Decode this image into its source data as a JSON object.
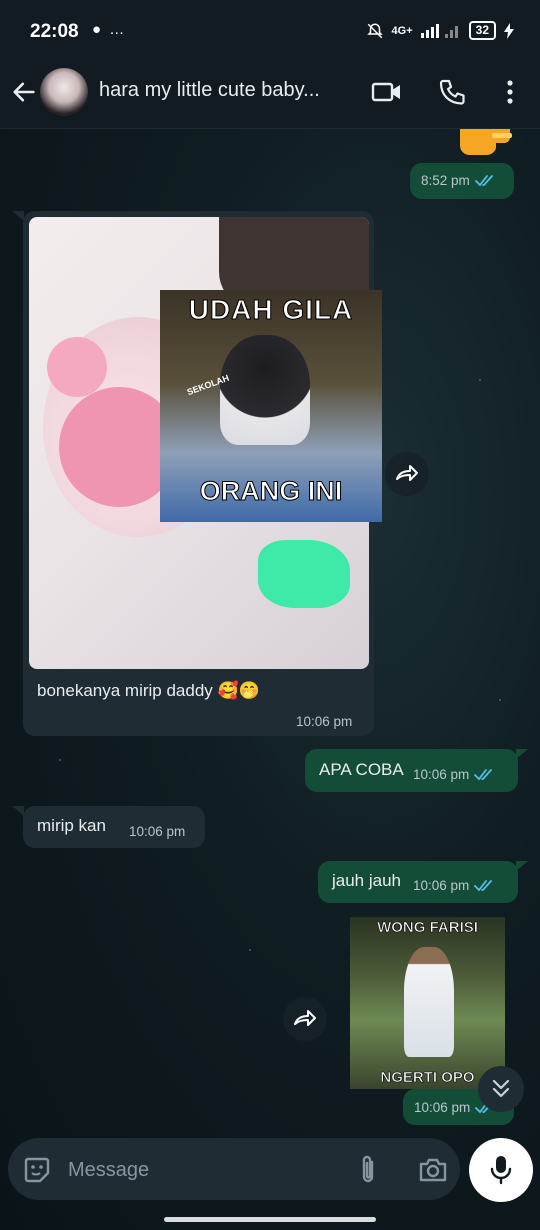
{
  "status_bar": {
    "time": "22:08",
    "left_icons": "● …",
    "network": "4G+",
    "battery": "32"
  },
  "header": {
    "title": "hara my little cute baby...",
    "icons": [
      "back-arrow-icon",
      "video-call-icon",
      "phone-icon",
      "more-vert-icon"
    ]
  },
  "messages": [
    {
      "id": "m0",
      "direction": "out",
      "time": "8:52 pm",
      "read": true
    },
    {
      "id": "m1",
      "direction": "in",
      "text": "bonekanya mirip daddy 🥰🤭",
      "time": "10:06 pm",
      "sticker_top": "UDAH GILA",
      "sticker_bottom": "ORANG INI",
      "sticker_small": "SEKOLAH"
    },
    {
      "id": "m2",
      "direction": "out",
      "text": "APA COBA",
      "time": "10:06 pm",
      "read": true
    },
    {
      "id": "m3",
      "direction": "in",
      "text": "mirip kan",
      "time": "10:06 pm"
    },
    {
      "id": "m4",
      "direction": "out",
      "text": "jauh jauh",
      "time": "10:06 pm",
      "read": true
    },
    {
      "id": "m5",
      "direction": "out",
      "sticker_top": "WONG FARISI",
      "sticker_bottom": "NGERTI OPO",
      "time": "10:06 pm",
      "read": true
    }
  ],
  "colors": {
    "outgoing_bubble": "#144d37",
    "incoming_bubble": "#1f2c34",
    "read_ticks": "#53bdeb",
    "header_bg": "#111b21"
  },
  "input": {
    "placeholder": "Message",
    "icons": [
      "sticker-icon",
      "attach-icon",
      "camera-icon",
      "mic-icon"
    ]
  }
}
